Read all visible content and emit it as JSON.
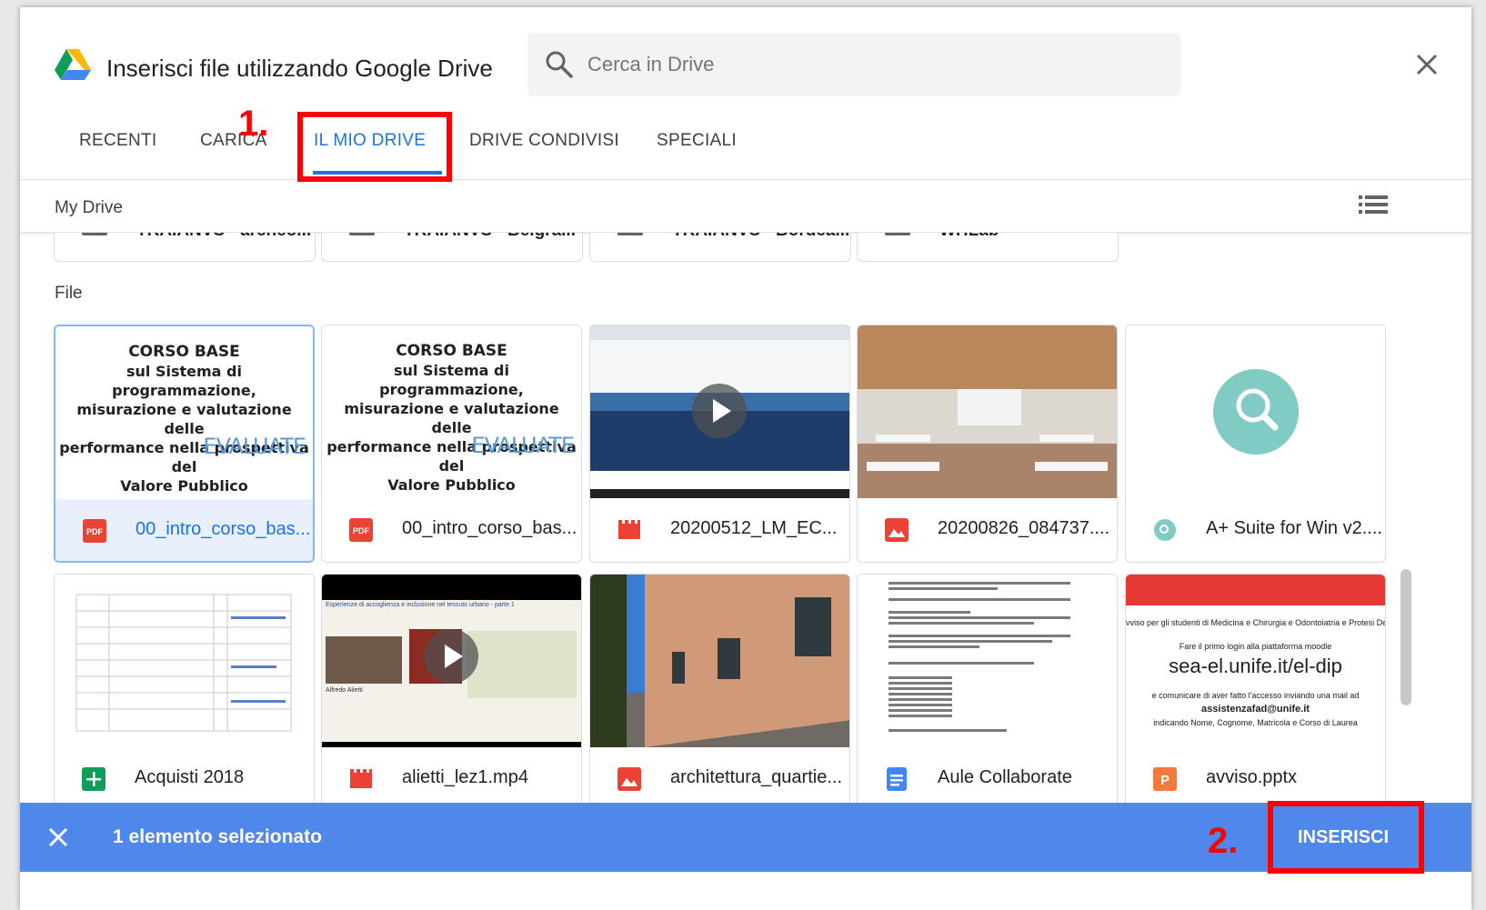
{
  "header": {
    "title": "Inserisci file utilizzando Google Drive",
    "search_placeholder": "Cerca in Drive"
  },
  "tabs": [
    {
      "label": "RECENTI"
    },
    {
      "label": "CARICA"
    },
    {
      "label": "IL MIO DRIVE",
      "active": true
    },
    {
      "label": "DRIVE CONDIVISI"
    },
    {
      "label": "SPECIALI"
    }
  ],
  "annotations": {
    "step1": "1.",
    "step2": "2."
  },
  "breadcrumb": "My Drive",
  "folders": [
    "TRAIANVS - archeo...",
    "TRAIANVS - Belgra...",
    "TRAIANVS - Bordea...",
    "WHLab"
  ],
  "section_label": "File",
  "files": [
    {
      "name": "00_intro_corso_bas...",
      "type": "pdf",
      "selected": true
    },
    {
      "name": "00_intro_corso_bas...",
      "type": "pdf",
      "selected": false
    },
    {
      "name": "20200512_LM_EC...",
      "type": "video",
      "selected": false
    },
    {
      "name": "20200826_084737....",
      "type": "image",
      "selected": false
    },
    {
      "name": "A+ Suite for Win v2....",
      "type": "app",
      "selected": false
    },
    {
      "name": "Acquisti 2018",
      "type": "sheet",
      "selected": false
    },
    {
      "name": "alietti_lez1.mp4",
      "type": "video",
      "selected": false
    },
    {
      "name": "architettura_quartie...",
      "type": "image",
      "selected": false
    },
    {
      "name": "Aule Collaborate",
      "type": "doc",
      "selected": false
    },
    {
      "name": "avviso.pptx",
      "type": "slides",
      "selected": false
    }
  ],
  "pdf_thumb": {
    "heading": "CORSO BASE",
    "line1": "sul Sistema di programmazione,",
    "line2": "misurazione e valutazione delle",
    "line3": "performance nella prospettiva del",
    "line4": "Valore Pubblico",
    "mark": "EVALUATE"
  },
  "avviso_thumb": {
    "line1": "vviso per gli studenti di Medicina e Chirurgia e Odontoiatria e Protesi Den",
    "line2": "Fare il primo login alla piattaforma moodle",
    "url": "sea-el.unife.it/el-dip",
    "line3": "e comunicare di aver fatto l'accesso inviando una mail ad",
    "email": "assistenzafad@unife.it",
    "line4": "indicando Nome, Cognome, Matricola e Corso di Laurea"
  },
  "video2_thumb": {
    "caption": "Esperienze di accoglienza e inclusione nel tessuto urbano - parte 1",
    "speaker": "Alfredo Alietti"
  },
  "bottom_bar": {
    "selected_text": "1 elemento selezionato",
    "insert_label": "INSERISCI"
  },
  "colors": {
    "accent": "#1a73e8",
    "bottom_bar": "#4f87ea",
    "annotation": "#ff0000"
  }
}
